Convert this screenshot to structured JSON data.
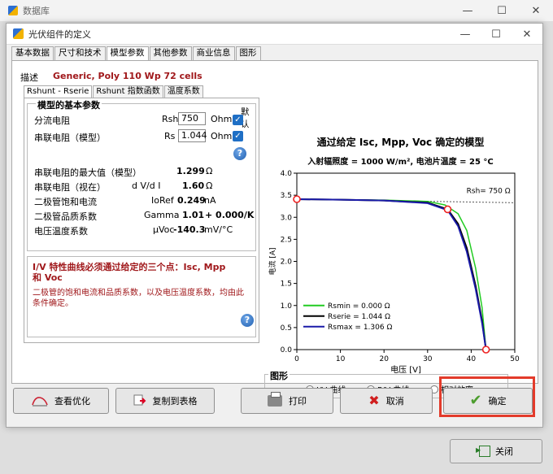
{
  "main_window": {
    "title": "数据库",
    "close_button": "关闭"
  },
  "dialog": {
    "title": "光伏组件的定义",
    "tabs": [
      "基本数据",
      "尺寸和技术",
      "模型参数",
      "其他参数",
      "商业信息",
      "图形"
    ],
    "active_tab": "模型参数",
    "description_label": "描述",
    "description_value": "Generic, Poly 110 Wp  72 cells",
    "subtabs": [
      "Rshunt - Rserie",
      "Rshunt 指数函数",
      "温度系数"
    ],
    "params": {
      "group_title": "模型的基本参数",
      "default_label": "默认",
      "rshunt_label": "分流电阻",
      "rshunt_symbol": "Rsh",
      "rshunt_value": "750",
      "rshunt_unit": "Ohm",
      "rserie_label": "串联电阻（模型）",
      "rserie_symbol": "Rs",
      "rserie_value": "1.044",
      "rserie_unit": "Ohm",
      "rs_max_label": "串联电阻的最大值（模型）",
      "rs_max_value": "1.299",
      "rs_max_unit": "Ω",
      "rs_app_label": "串联电阻（视在）",
      "rs_app_symbol": "d V/d I",
      "rs_app_value": "1.60",
      "rs_app_unit": "Ω",
      "diode_sat_label": "二极管饱和电流",
      "diode_sat_symbol": "IoRef",
      "diode_sat_value": "0.249",
      "diode_sat_unit": "nA",
      "diode_q_label": "二极管品质系数",
      "diode_q_symbol": "Gamma",
      "diode_q_value": "1.01",
      "diode_q_extra": "+ 0.000/K",
      "voc_temp_label": "电压温度系数",
      "voc_temp_symbol": "μVoc",
      "voc_temp_value": "-140.3",
      "voc_temp_unit": "mV/°C"
    },
    "warning": {
      "title": "I/V 特性曲线必须通过给定的三个点：Isc, Mpp 和 Voc",
      "text": "二极管的饱和电流和品质系数，以及电压温度系数，均由此条件确定。"
    },
    "chart_header": {
      "title": "通过给定 Isc, Mpp, Voc 确定的模型",
      "subtitle": "入射辐照度 = 1000 W/m², 电池片温度 = 25 °C"
    },
    "graph_group": {
      "title": "图形",
      "options": [
        "I/V 曲线",
        "P/V 曲线",
        "相对效率"
      ],
      "selected": "I/V 曲线"
    },
    "buttons": {
      "optimize": "查看优化",
      "copy_table": "复制到表格",
      "print": "打印",
      "cancel": "取消",
      "ok": "确定"
    }
  },
  "chart_data": {
    "type": "line",
    "xlabel": "电压 [V]",
    "ylabel": "电流 [A]",
    "xlim": [
      0,
      50
    ],
    "ylim": [
      0,
      4.0
    ],
    "x_ticks": [
      0,
      10,
      20,
      30,
      40,
      50
    ],
    "y_ticks": [
      0,
      0.5,
      1.0,
      1.5,
      2.0,
      2.5,
      3.0,
      3.5,
      4.0
    ],
    "annotation": "Rsh= 750 Ω",
    "key_points": [
      {
        "x": 0,
        "y": 3.41
      },
      {
        "x": 34.6,
        "y": 3.18
      },
      {
        "x": 43.4,
        "y": 0
      }
    ],
    "series": [
      {
        "name": "Rsmin = 0.000 Ω",
        "color": "#22cc22",
        "x": [
          0,
          10,
          20,
          30,
          34,
          37,
          39,
          41,
          42.5,
          43.4
        ],
        "y": [
          3.41,
          3.4,
          3.39,
          3.36,
          3.28,
          3.08,
          2.7,
          1.85,
          0.95,
          0
        ]
      },
      {
        "name": "Rserie = 1.044 Ω",
        "color": "#000000",
        "x": [
          0,
          10,
          20,
          30,
          34.6,
          37,
          39,
          41,
          42.5,
          43.4
        ],
        "y": [
          3.41,
          3.4,
          3.38,
          3.33,
          3.18,
          2.85,
          2.3,
          1.45,
          0.65,
          0
        ]
      },
      {
        "name": "Rsmax = 1.306 Ω",
        "color": "#1a1aa8",
        "x": [
          0,
          10,
          20,
          30,
          34.6,
          37,
          39,
          41,
          42.5,
          43.4
        ],
        "y": [
          3.41,
          3.4,
          3.38,
          3.32,
          3.16,
          2.8,
          2.22,
          1.38,
          0.6,
          0
        ]
      }
    ]
  }
}
